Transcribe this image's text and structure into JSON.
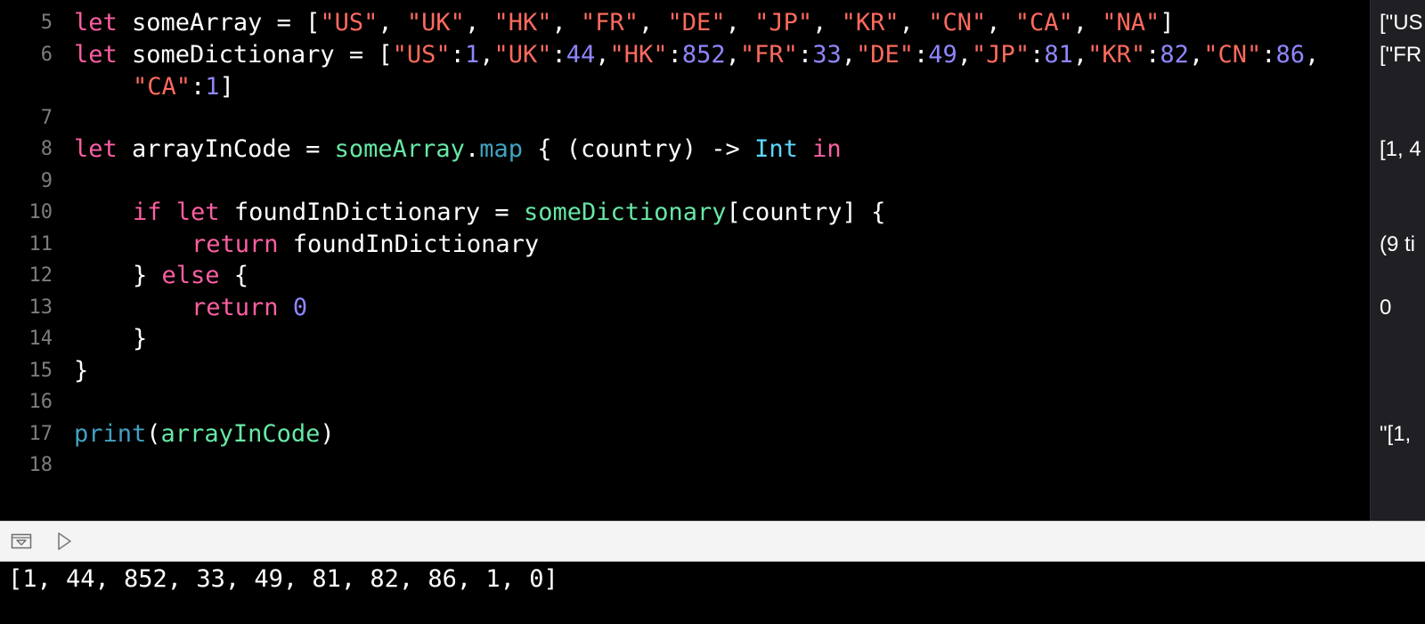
{
  "editor": {
    "line_numbers": [
      "5",
      "6",
      "",
      "7",
      "8",
      "9",
      "10",
      "11",
      "12",
      "13",
      "14",
      "15",
      "16",
      "17",
      "18"
    ],
    "lines": {
      "l5": {
        "let": "let",
        "name": " someArray = [",
        "s1": "\"US\"",
        "c1": ", ",
        "s2": "\"UK\"",
        "c2": ", ",
        "s3": "\"HK\"",
        "c3": ", ",
        "s4": "\"FR\"",
        "c4": ", ",
        "s5": "\"DE\"",
        "c5": ", ",
        "s6": "\"JP\"",
        "c6": ", ",
        "s7": "\"KR\"",
        "c7": ", ",
        "s8": "\"CN\"",
        "c8": ", ",
        "s9": "\"CA\"",
        "c9": ", ",
        "s10": "\"NA\"",
        "end": "]"
      },
      "l6": {
        "let": "let",
        "name": " someDictionary = [",
        "k1": "\"US\"",
        "p1": ":",
        "v1": "1",
        "q1": ",",
        "k2": "\"UK\"",
        "p2": ":",
        "v2": "44",
        "q2": ",",
        "k3": "\"HK\"",
        "p3": ":",
        "v3": "852",
        "q3": ",",
        "k4": "\"FR\"",
        "p4": ":",
        "v4": "33",
        "q4": ",",
        "k5": "\"DE\"",
        "p5": ":",
        "v5": "49",
        "q5": ",",
        "k6": "\"JP\"",
        "p6": ":",
        "v6": "81",
        "q6": ",",
        "k7": "\"KR\"",
        "p7": ":",
        "v7": "82",
        "q7": ",",
        "k8": "\"CN\"",
        "p8": ":",
        "v8": "86",
        "q8": ","
      },
      "l6b": {
        "k9": "\"CA\"",
        "p9": ":",
        "v9": "1",
        "end": "]"
      },
      "l8": {
        "let": "let",
        "name": " arrayInCode = ",
        "obj": "someArray",
        "dot": ".",
        "method": "map",
        "mid": " { (country) -> ",
        "type": "Int",
        "sp": " ",
        "kin": "in"
      },
      "l10": {
        "kif": "if",
        "sp": " ",
        "klet": "let",
        "mid": " foundInDictionary = ",
        "dict": "someDictionary",
        "tail": "[country] {"
      },
      "l11": {
        "kret": "return",
        "rest": " foundInDictionary"
      },
      "l12": {
        "pre": "} ",
        "kelse": "else",
        "post": " {"
      },
      "l13": {
        "kret": "return",
        "sp": " ",
        "num": "0"
      },
      "l14": {
        "brace": "}"
      },
      "l15": {
        "brace": "}"
      },
      "l17": {
        "fn": "print",
        "open": "(",
        "arg": "arrayInCode",
        "close": ")"
      }
    }
  },
  "results": [
    "[\"US",
    "[\"FR",
    "[1, 4",
    "(9 ti",
    "0",
    "\"[1, "
  ],
  "console": {
    "output": "[1, 44, 852, 33, 49, 81, 82, 86, 1, 0]"
  },
  "colors": {
    "keyword": "#fc5fa3",
    "string": "#fc6a5d",
    "number": "#8f86fe",
    "function": "#41a1c0",
    "project_symbol": "#67e8a5",
    "type": "#5dd8ff",
    "plain": "#ffffff",
    "line_number": "#7d7d7d",
    "background": "#000000"
  },
  "icons": {
    "toggle_console": "hide-debug-area-icon",
    "run": "run-play-icon"
  }
}
